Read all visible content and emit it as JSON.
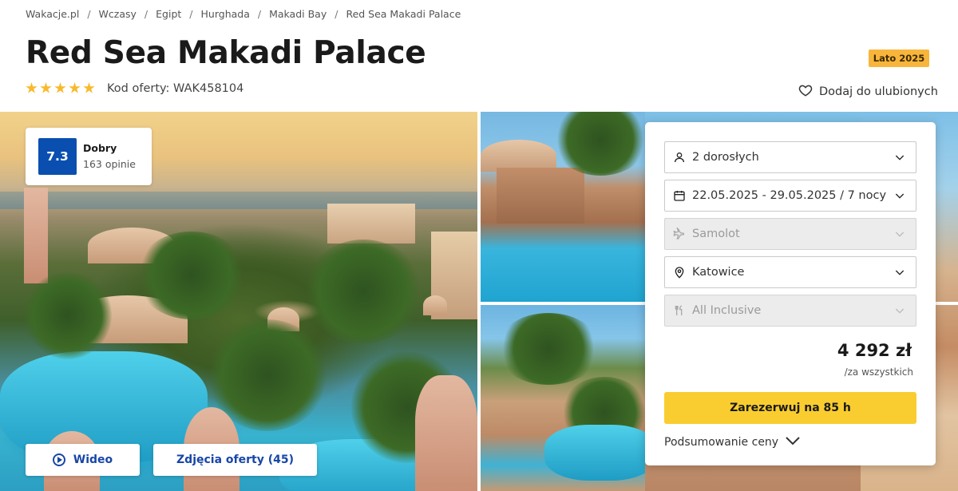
{
  "breadcrumb": [
    "Wakacje.pl",
    "Wczasy",
    "Egipt",
    "Hurghada",
    "Makadi Bay",
    "Red Sea Makadi Palace"
  ],
  "breadcrumb_separator": "/",
  "hotel": {
    "name": "Red Sea Makadi Palace",
    "stars": 5,
    "offer_code": "Kod oferty: WAK458104",
    "season_badge": "Lato 2025",
    "favorite_label": "Dodaj do ulubionych"
  },
  "rating": {
    "score": "7.3",
    "label": "Dobry",
    "reviews": "163 opinie"
  },
  "media": {
    "video_label": "Wideo",
    "photos_label": "Zdjęcia oferty (45)"
  },
  "booking": {
    "travelers": "2 dorosłych",
    "dates": "22.05.2025 - 29.05.2025 / 7 nocy",
    "transport": "Samolot",
    "departure": "Katowice",
    "board": "All Inclusive",
    "price": "4 292 zł",
    "price_note": "/za wszystkich",
    "book_label": "Zarezerwuj na 85 h",
    "summary_label": "Podsumowanie ceny"
  },
  "colors": {
    "accent_blue": "#0a4fb0",
    "link_blue": "#1846a8",
    "cta_yellow": "#f9cd2f",
    "badge_orange": "#f8b53c",
    "star_yellow": "#f8b92b"
  },
  "icons": {
    "favorite": "heart-icon",
    "travelers": "person-icon",
    "dates": "calendar-icon",
    "transport": "plane-icon",
    "departure": "location-pin-icon",
    "board": "cutlery-icon",
    "video": "play-icon",
    "dropdown": "chevron-down-icon"
  }
}
